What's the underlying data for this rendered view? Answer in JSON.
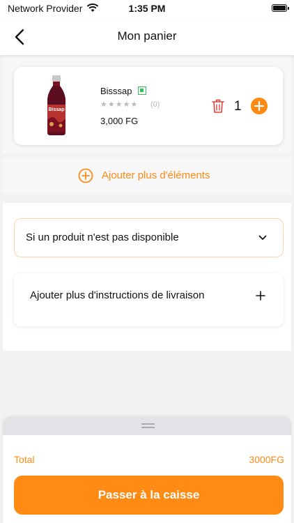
{
  "status_bar": {
    "carrier": "Network Provider",
    "time": "1:35 PM"
  },
  "navbar": {
    "title": "Mon panier"
  },
  "cart": {
    "items": [
      {
        "name": "Bisssap",
        "rating_count": "(0)",
        "rating_stars": 0,
        "price": "3,000 FG",
        "quantity": "1",
        "image_label": "Bissap"
      }
    ]
  },
  "add_more": {
    "label": "Ajouter plus d'éléments"
  },
  "options": {
    "unavailable_label": "Si un produit n'est pas disponible",
    "instructions_label": "Ajouter plus d'instructions de livraison"
  },
  "summary": {
    "total_label": "Total",
    "total_value": "3000FG",
    "checkout_label": "Passer à la caisse"
  },
  "colors": {
    "accent": "#ff8a14",
    "delete": "#e0403c",
    "veg": "#2ec05a"
  }
}
